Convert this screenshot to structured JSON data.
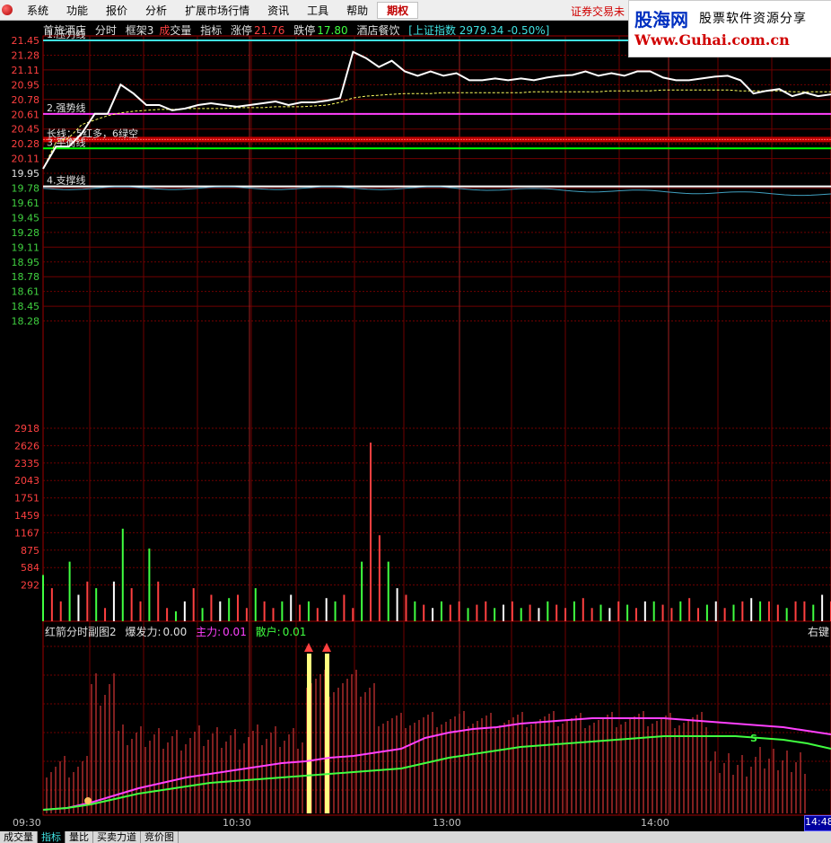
{
  "menubar": {
    "items": [
      "系统",
      "功能",
      "报价",
      "分析",
      "扩展市场行情",
      "资讯",
      "工具",
      "帮助"
    ],
    "qiquan": "期权",
    "notice": "证券交易未"
  },
  "watermark": {
    "brand": "股海网",
    "slogan": "股票软件资源分享",
    "url": "Www.Guhai.com.cn"
  },
  "infobar": {
    "stock_name": "首旅酒店",
    "mode": "分时",
    "frame": "框架3",
    "cheng": "成",
    "jiaoliang": "交量",
    "zhibiao": "指标",
    "zhangting_label": "涨停",
    "zhangting_value": "21.76",
    "dieting_label": "跌停",
    "dieting_value": "17.80",
    "sector": "酒店餐饮",
    "index_text": "[上证指数 2979.34 -0.50%]"
  },
  "price_axis": [
    "21.45",
    "21.28",
    "21.11",
    "20.95",
    "20.78",
    "20.61",
    "20.45",
    "20.28",
    "20.11",
    "19.95",
    "19.78",
    "19.61",
    "19.45",
    "19.28",
    "19.11",
    "18.95",
    "18.78",
    "18.61",
    "18.45",
    "18.28"
  ],
  "volume_axis": [
    "2918",
    "2626",
    "2335",
    "2043",
    "1751",
    "1459",
    "1167",
    "875",
    "584",
    "292"
  ],
  "lines": {
    "pressure": "1.压力线",
    "strong": "2.强势线",
    "long_short": "长线：5红多，6绿空",
    "balance": "3.平衡线",
    "support": "4.支撑线"
  },
  "subchart": {
    "title": "红箭分时副图2",
    "baofa_label": "爆发力:",
    "baofa_value": "0.00",
    "zhuli_label": "主力:",
    "zhuli_value": "0.01",
    "sanhu_label": "散户:",
    "sanhu_value": "0.01",
    "right_label": "右键",
    "s_mark": "S"
  },
  "time_axis": [
    "09:30",
    "10:30",
    "13:00",
    "14:00"
  ],
  "time_current": "14:48",
  "bottom_tabs": [
    "成交量",
    "指标",
    "量比",
    "买卖力道",
    "竞价图"
  ],
  "colors": {
    "price_line": "#ffffff",
    "avg_line": "#ffff60",
    "pressure": "#40e0e0",
    "strong": "#ff40ff",
    "balance": "#00ff00",
    "support": "#ffffff",
    "zhuli": "#ff40ff",
    "sanhu": "#40ff40"
  },
  "chart_data": {
    "type": "line",
    "price": {
      "ylim": [
        18.28,
        21.45
      ],
      "series": [
        {
          "values": [
            20.0,
            20.25,
            20.25,
            20.4,
            20.62,
            20.62,
            20.95,
            20.85,
            20.72,
            20.72,
            20.66,
            20.68,
            20.72,
            20.74,
            20.72,
            20.7,
            20.72,
            20.74,
            20.76,
            20.72,
            20.75,
            20.75,
            20.77,
            20.8,
            21.32,
            21.25,
            21.15,
            21.22,
            21.1,
            21.05,
            21.1,
            21.05,
            21.08,
            21.0,
            21.0,
            21.02,
            21.0,
            21.02,
            21.0,
            21.03,
            21.05,
            21.06,
            21.1,
            21.05,
            21.08,
            21.05,
            21.1,
            21.1,
            21.03,
            21.0,
            21.0,
            21.02,
            21.04,
            21.05,
            21.0,
            20.85,
            20.88,
            20.9,
            20.82,
            20.86,
            20.82,
            20.84
          ]
        },
        {
          "values": [
            20.0,
            20.3,
            20.35,
            20.5,
            20.55,
            20.6,
            20.63,
            20.65,
            20.66,
            20.67,
            20.67,
            20.68,
            20.68,
            20.68,
            20.68,
            20.69,
            20.69,
            20.69,
            20.7,
            20.7,
            20.7,
            20.71,
            20.72,
            20.75,
            20.8,
            20.82,
            20.83,
            20.84,
            20.85,
            20.85,
            20.85,
            20.86,
            20.86,
            20.86,
            20.86,
            20.86,
            20.86,
            20.86,
            20.87,
            20.87,
            20.87,
            20.87,
            20.87,
            20.87,
            20.88,
            20.88,
            20.88,
            20.88,
            20.89,
            20.89,
            20.89,
            20.89,
            20.89,
            20.89,
            20.88,
            20.88,
            20.88,
            20.88,
            20.87,
            20.87,
            20.87,
            20.87
          ]
        }
      ]
    },
    "volume": {
      "ylim": [
        0,
        2918
      ],
      "values": [
        700,
        500,
        300,
        900,
        400,
        600,
        500,
        200,
        600,
        1400,
        500,
        300,
        1100,
        600,
        200,
        150,
        300,
        500,
        200,
        400,
        300,
        350,
        400,
        200,
        500,
        300,
        200,
        300,
        400,
        250,
        300,
        200,
        350,
        300,
        400,
        200,
        900,
        2700,
        1300,
        900,
        500,
        400,
        300,
        250,
        200,
        300,
        250,
        300,
        200,
        250,
        300,
        200,
        250,
        300,
        200,
        250,
        200,
        300,
        250,
        200,
        300,
        350,
        200,
        250,
        200,
        300,
        250,
        200,
        300,
        300,
        250,
        200,
        300,
        350,
        200,
        250,
        300,
        200,
        250,
        300,
        350,
        300,
        300,
        250,
        200,
        300,
        300,
        250,
        400,
        300
      ]
    },
    "subchart": {
      "ylim": [
        0,
        100
      ],
      "series": [
        {
          "name": "主力",
          "values": [
            2,
            3,
            6,
            10,
            14,
            17,
            20,
            22,
            24,
            26,
            28,
            29,
            31,
            32,
            34,
            36,
            42,
            45,
            47,
            48,
            50,
            51,
            52,
            53,
            53,
            53,
            53,
            52,
            51,
            50,
            49,
            48,
            46,
            44
          ]
        },
        {
          "name": "散户",
          "values": [
            2,
            3,
            5,
            8,
            11,
            13,
            15,
            17,
            18,
            19,
            20,
            21,
            22,
            23,
            24,
            25,
            28,
            31,
            33,
            35,
            37,
            38,
            39,
            40,
            41,
            42,
            43,
            43,
            43,
            43,
            42,
            41,
            39,
            36
          ]
        }
      ]
    },
    "xlabel": "",
    "ylabel": ""
  }
}
